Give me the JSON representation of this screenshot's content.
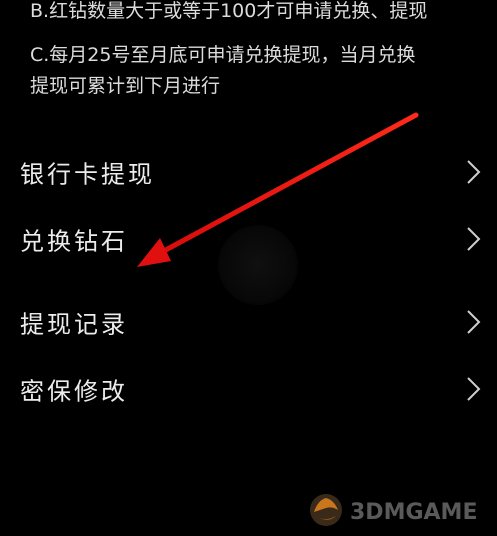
{
  "rules": {
    "line_b": "B.红钻数量大于或等于100才可申请兑换、提现",
    "line_c1": "C.每月25号至月底可申请兑换提现，当月兑换",
    "line_c2": "提现可累计到下月进行"
  },
  "menu": {
    "items": [
      {
        "label": "银行卡提现",
        "icon": "chevron-right-icon"
      },
      {
        "label": "兑换钻石",
        "icon": "chevron-right-icon"
      },
      {
        "label": "提现记录",
        "icon": "chevron-right-icon"
      },
      {
        "label": "密保修改",
        "icon": "chevron-right-icon"
      }
    ]
  },
  "annotation": {
    "arrow_color": "#e01010",
    "points_to": "兑换钻石"
  },
  "watermark": {
    "text": "3DMGAME",
    "logo": "3dm-logo-icon"
  },
  "colors": {
    "background": "#000000",
    "text": "#ececec",
    "chevron": "#cfcfcf"
  }
}
